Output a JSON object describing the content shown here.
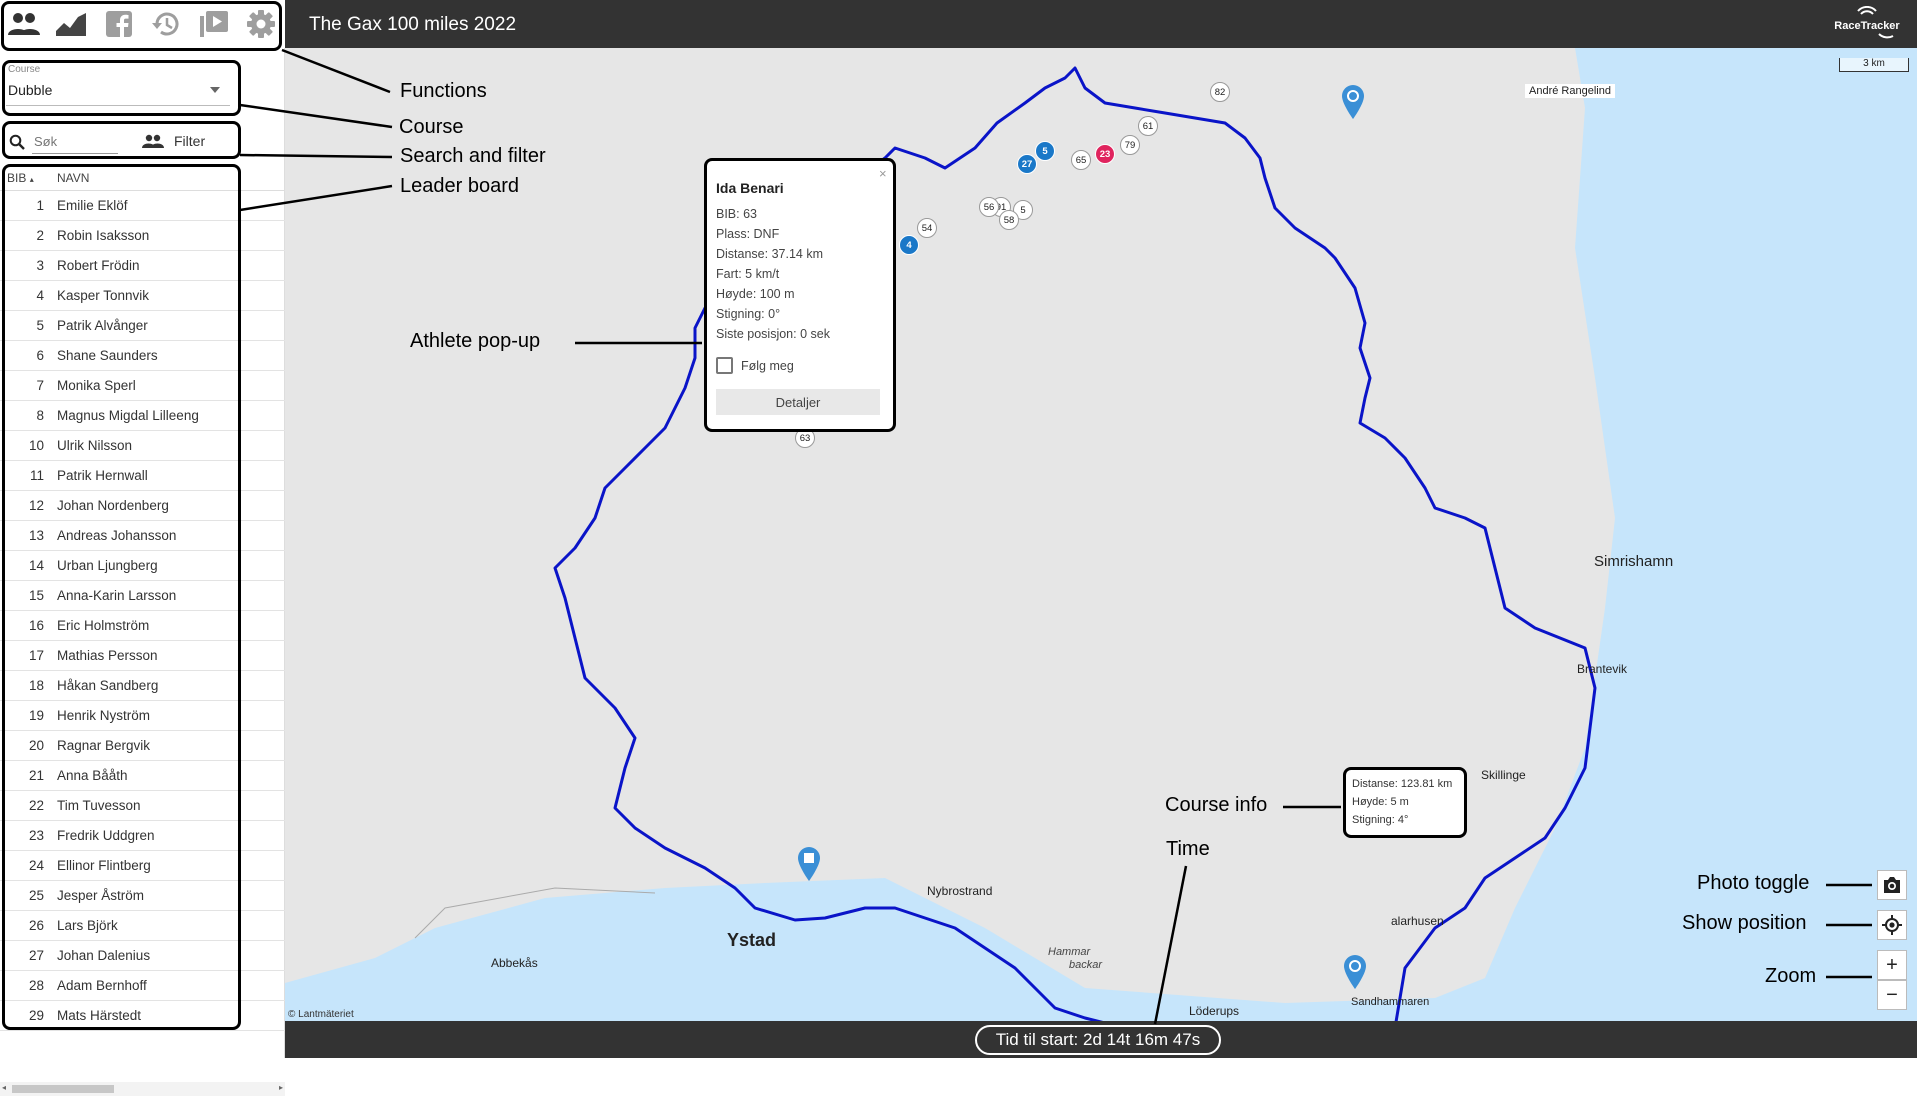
{
  "header": {
    "title": "The Gax 100 miles 2022",
    "logo_text": "RaceTracker",
    "tools": [
      {
        "name": "participants",
        "icon": "people-icon"
      },
      {
        "name": "elevation",
        "icon": "chart-icon"
      },
      {
        "name": "facebook",
        "icon": "facebook-icon"
      },
      {
        "name": "history",
        "icon": "history-icon"
      },
      {
        "name": "replay",
        "icon": "video-icon"
      },
      {
        "name": "settings",
        "icon": "gear-icon"
      }
    ]
  },
  "sidebar": {
    "course_label": "Course",
    "course_value": "Dubble",
    "search_placeholder": "Søk",
    "filter_label": "Filter",
    "collapse_glyph": "›",
    "leaderboard": {
      "columns": {
        "bib": "BIB",
        "bib_sort": "▴",
        "name": "NAVN"
      },
      "rows": [
        {
          "bib": "1",
          "name": "Emilie Eklöf"
        },
        {
          "bib": "2",
          "name": "Robin Isaksson"
        },
        {
          "bib": "3",
          "name": "Robert Frödin"
        },
        {
          "bib": "4",
          "name": "Kasper Tonnvik"
        },
        {
          "bib": "5",
          "name": "Patrik Alvånger"
        },
        {
          "bib": "6",
          "name": "Shane Saunders"
        },
        {
          "bib": "7",
          "name": "Monika Sperl"
        },
        {
          "bib": "8",
          "name": "Magnus Migdal Lilleeng"
        },
        {
          "bib": "10",
          "name": "Ulrik Nilsson"
        },
        {
          "bib": "11",
          "name": "Patrik Hernwall"
        },
        {
          "bib": "12",
          "name": "Johan Nordenberg"
        },
        {
          "bib": "13",
          "name": "Andreas Johansson"
        },
        {
          "bib": "14",
          "name": "Urban Ljungberg"
        },
        {
          "bib": "15",
          "name": "Anna-Karin Larsson"
        },
        {
          "bib": "16",
          "name": "Eric Holmström"
        },
        {
          "bib": "17",
          "name": "Mathias Persson"
        },
        {
          "bib": "18",
          "name": "Håkan Sandberg"
        },
        {
          "bib": "19",
          "name": "Henrik Nyström"
        },
        {
          "bib": "20",
          "name": "Ragnar Bergvik"
        },
        {
          "bib": "21",
          "name": "Anna Bååth"
        },
        {
          "bib": "22",
          "name": "Tim Tuvesson"
        },
        {
          "bib": "23",
          "name": "Fredrik Uddgren"
        },
        {
          "bib": "24",
          "name": "Ellinor Flintberg"
        },
        {
          "bib": "25",
          "name": "Jesper Åström"
        },
        {
          "bib": "26",
          "name": "Lars Björk"
        },
        {
          "bib": "27",
          "name": "Johan Dalenius"
        },
        {
          "bib": "28",
          "name": "Adam Bernhoff"
        },
        {
          "bib": "29",
          "name": "Mats Härstedt"
        }
      ]
    }
  },
  "map": {
    "scale": "3 km",
    "copyright": "© Lantmäteriet",
    "places": {
      "ystad": "Ystad",
      "nybrostrand": "Nybrostrand",
      "abbekas": "Abbekås",
      "hammars": "Hammar",
      "backar": "backar",
      "loderups": "Löderups",
      "sandhammaren": "Sandhammaren",
      "skillinge": "Skillinge",
      "brantevik": "Brantevik",
      "simrishamn": "Simrishamn",
      "alarhusen": "alarhusen"
    },
    "athlete_label": "André Rangelind",
    "runner_markers": {
      "m82": "82",
      "m61": "61",
      "m79": "79",
      "m23": "23",
      "m65": "65",
      "m5": "5",
      "m27": "27",
      "m56": "56",
      "m91": "91",
      "m5b": "5",
      "m58": "58",
      "m54": "54",
      "m4": "4",
      "m63": "63"
    }
  },
  "popup": {
    "name": "Ida Benari",
    "close": "×",
    "lines": [
      "BIB: 63",
      "Plass: DNF",
      "Distanse: 37.14 km",
      "Fart: 5 km/t",
      "Høyde: 100 m",
      "Stigning: 0°",
      "Siste posisjon: 0 sek"
    ],
    "follow_label": "Følg meg",
    "details_label": "Detaljer"
  },
  "course_info": {
    "lines": [
      "Distanse: 123.81 km",
      "Høyde: 5 m",
      "Stigning: 4°"
    ]
  },
  "controls": {
    "zoom_in": "+",
    "zoom_out": "−"
  },
  "countdown": "Tid til start: 2d 14t 16m 47s",
  "annotations": {
    "functions": "Functions",
    "course": "Course",
    "search_filter": "Search and filter",
    "leaderboard": "Leader board",
    "athlete_popup": "Athlete pop-up",
    "course_info": "Course info",
    "time": "Time",
    "photo_toggle": "Photo toggle",
    "show_position": "Show position",
    "zoom": "Zoom"
  },
  "colors": {
    "header_bg": "#333333",
    "route": "#0a14c8",
    "sea": "#c6e5fb",
    "land": "#e6e6e6",
    "runner_blue": "#1a78c8",
    "runner_red": "#e0245e"
  }
}
